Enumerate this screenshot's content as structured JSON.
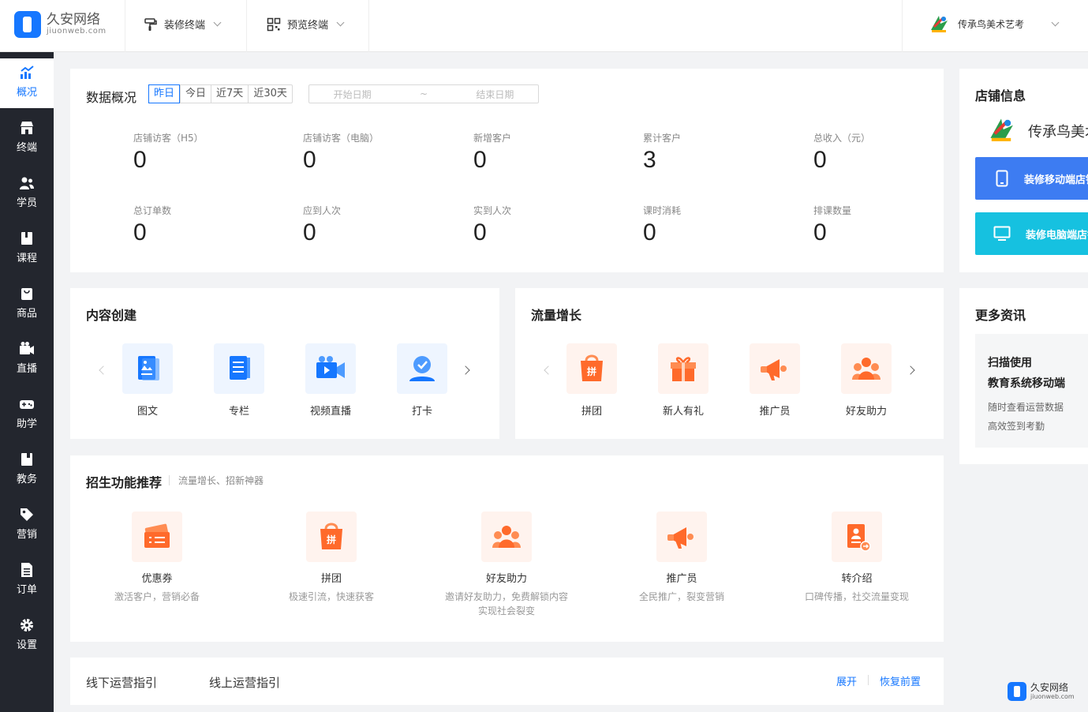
{
  "brand": {
    "name": "久安网络",
    "domain": "jiuonweb.com"
  },
  "topbar": {
    "decorate": "装修终端",
    "preview": "预览终端",
    "shop": "传承鸟美术艺考"
  },
  "sidebar": [
    {
      "label": "概况",
      "icon": "chart-icon"
    },
    {
      "label": "终端",
      "icon": "store-icon"
    },
    {
      "label": "学员",
      "icon": "users-icon"
    },
    {
      "label": "课程",
      "icon": "book-icon"
    },
    {
      "label": "商品",
      "icon": "bag-icon"
    },
    {
      "label": "直播",
      "icon": "camera-icon"
    },
    {
      "label": "助学",
      "icon": "gamepad-icon"
    },
    {
      "label": "教务",
      "icon": "notebook-icon"
    },
    {
      "label": "营销",
      "icon": "tag-icon"
    },
    {
      "label": "订单",
      "icon": "document-icon"
    },
    {
      "label": "设置",
      "icon": "gear-icon"
    }
  ],
  "overview": {
    "title": "数据概况",
    "ranges": [
      "昨日",
      "今日",
      "近7天",
      "近30天"
    ],
    "start_placeholder": "开始日期",
    "sep": "~",
    "end_placeholder": "结束日期",
    "stats": [
      {
        "label": "店铺访客（H5）",
        "value": "0"
      },
      {
        "label": "店铺访客（电脑）",
        "value": "0"
      },
      {
        "label": "新增客户",
        "value": "0"
      },
      {
        "label": "累计客户",
        "value": "3"
      },
      {
        "label": "总收入（元）",
        "value": "0"
      },
      {
        "label": "总订单数",
        "value": "0"
      },
      {
        "label": "应到人次",
        "value": "0"
      },
      {
        "label": "实到人次",
        "value": "0"
      },
      {
        "label": "课时消耗",
        "value": "0"
      },
      {
        "label": "排课数量",
        "value": "0"
      }
    ]
  },
  "content": {
    "title": "内容创建",
    "items": [
      "图文",
      "专栏",
      "视频直播",
      "打卡"
    ]
  },
  "traffic": {
    "title": "流量增长",
    "items": [
      "拼团",
      "新人有礼",
      "推广员",
      "好友助力"
    ]
  },
  "recommend": {
    "title": "招生功能推荐",
    "subtitle": "流量增长、招新神器",
    "items": [
      {
        "label": "优惠券",
        "desc": "激活客户，营销必备"
      },
      {
        "label": "拼团",
        "desc": "极速引流，快速获客"
      },
      {
        "label": "好友助力",
        "desc": "邀请好友助力，免费解锁内容",
        "desc2": "实现社会裂变"
      },
      {
        "label": "推广员",
        "desc": "全民推广，裂变营销"
      },
      {
        "label": "转介绍",
        "desc": "口碑传播，社交流量变现"
      }
    ]
  },
  "guide": {
    "offline": "线下运营指引",
    "online": "线上运营指引",
    "expand": "展开",
    "restore": "恢复前置"
  },
  "shopinfo": {
    "title": "店铺信息",
    "name": "传承鸟美术艺考",
    "mobile": "装修移动端店铺",
    "pc": "装修电脑端店铺"
  },
  "more": {
    "title": "更多资讯",
    "line1": "扫描使用",
    "line2": "教育系统移动端",
    "line3": "随时查看运营数据",
    "line4": "高效签到考勤"
  },
  "colors": {
    "accent": "#1677ff",
    "sidebar": "#23262e",
    "orange": "#ff6a2b",
    "blue_icon": "#1677ff"
  }
}
